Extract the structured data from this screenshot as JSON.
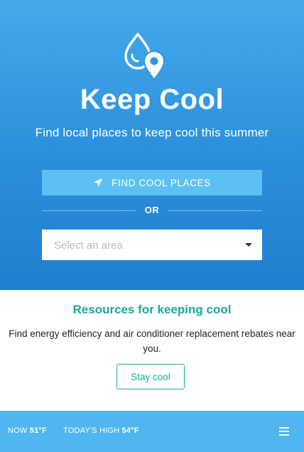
{
  "hero": {
    "logo_icon": "water-drop-location-pin-icon",
    "title": "Keep Cool",
    "tagline": "Find local places to keep cool this summer",
    "find_button": {
      "icon": "navigation-arrow-icon",
      "label": "FIND COOL PLACES"
    },
    "separator_text": "OR",
    "area_select": {
      "placeholder": "Select an area",
      "icon": "caret-down-icon"
    }
  },
  "resources": {
    "title": "Resources for keeping cool",
    "text": "Find energy efficiency and air conditioner replacement rebates near you.",
    "button_label": "Stay cool"
  },
  "footer": {
    "now_label": "NOW",
    "now_value": "51°F",
    "high_label": "TODAY'S HIGH",
    "high_value": "54°F",
    "menu_icon": "hamburger-menu-icon"
  },
  "colors": {
    "hero_top": "#45aaea",
    "hero_bottom": "#1f7fd0",
    "button_blue": "#5cc1f2",
    "accent_teal": "#1aa89b",
    "footer_blue": "#4fb6ef"
  }
}
